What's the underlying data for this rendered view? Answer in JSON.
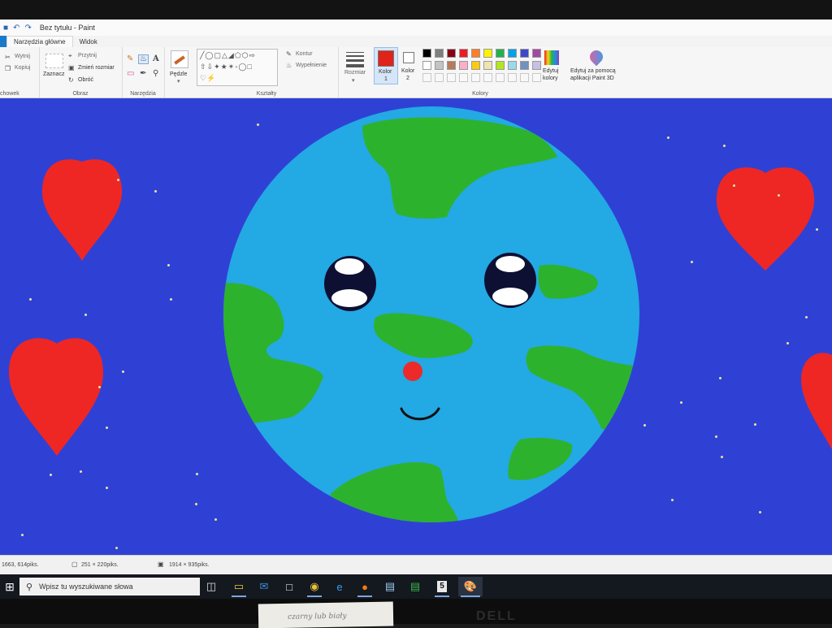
{
  "window": {
    "title": "Bez tytułu - Paint",
    "quick_access_icons": [
      "save-icon",
      "undo-icon",
      "redo-icon"
    ]
  },
  "tabs": [
    {
      "label": "Narzędzia główne",
      "active": true
    },
    {
      "label": "Widok",
      "active": false
    }
  ],
  "ribbon": {
    "clipboard": {
      "cut": "Wytnij",
      "copy": "Kopiuj",
      "group": "chowek"
    },
    "image": {
      "select": "Zaznacz",
      "crop": "Przytnij",
      "resize": "Zmień rozmiar",
      "rotate": "Obróć",
      "group": "Obraz"
    },
    "tools": {
      "group": "Narzędzia",
      "icons": [
        "pencil-icon",
        "fill-icon",
        "text-icon",
        "eraser-icon",
        "color-picker-icon",
        "magnifier-icon"
      ]
    },
    "brushes": {
      "label": "Pędzle"
    },
    "shapes": {
      "group": "Kształty",
      "outline": "Kontur",
      "fill": "Wypełnienie"
    },
    "size": {
      "label": "Rozmiar"
    },
    "color1": {
      "label": "Kolor",
      "number": "1",
      "color": "#e0231b"
    },
    "color2": {
      "label": "Kolor",
      "number": "2",
      "color": "#ffffff"
    },
    "colors": {
      "group": "Kolory",
      "row1": [
        "#000000",
        "#7f7f7f",
        "#880015",
        "#ed1c24",
        "#ff7f27",
        "#fff200",
        "#22b14c",
        "#00a2e8",
        "#3f48cc",
        "#a349a4"
      ],
      "row2": [
        "#ffffff",
        "#c3c3c3",
        "#b97a57",
        "#ffaec9",
        "#ffc90e",
        "#efe4b0",
        "#b5e61d",
        "#99d9ea",
        "#7092be",
        "#c8bfe7"
      ]
    },
    "edit_colors": {
      "line1": "Edytuj",
      "line2": "kolory"
    },
    "paint3d": {
      "line1": "Edytuj za pomocą",
      "line2": "aplikacji Paint 3D"
    }
  },
  "canvas": {
    "background": "#2f41d5",
    "ocean": "#23a9e4",
    "land": "#2db22e",
    "heart": "#ee2724",
    "nose": "#ec2a2a"
  },
  "status": {
    "cursor": "1663, 614piks.",
    "selection": "251 × 220piks.",
    "image_size": "1914 × 935piks."
  },
  "taskbar": {
    "search_placeholder": "Wpisz tu wyszukiwane słowa",
    "icons": [
      "windows-start-icon",
      "search-icon",
      "task-view-icon",
      "file-explorer-icon",
      "mail-icon",
      "store-icon",
      "chrome-icon",
      "edge-icon",
      "firefox-icon",
      "file-icon",
      "excel-file-icon",
      "app-5-icon",
      "paint-icon"
    ],
    "app_label_5": "5"
  },
  "monitor": {
    "brand": "DELL",
    "note": "czarny lub biały"
  }
}
